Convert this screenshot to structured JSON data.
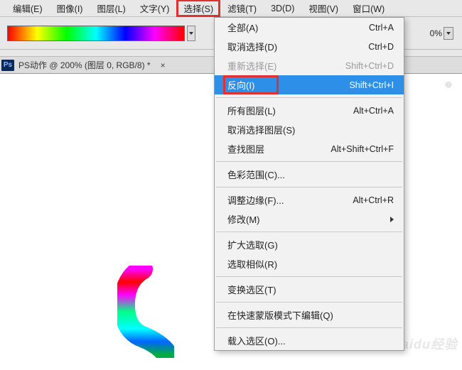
{
  "menubar": {
    "items": [
      {
        "label": "编辑(E)"
      },
      {
        "label": "图像(I)"
      },
      {
        "label": "图层(L)"
      },
      {
        "label": "文字(Y)"
      },
      {
        "label": "选择(S)",
        "highlighted": true
      },
      {
        "label": "滤镜(T)"
      },
      {
        "label": "3D(D)"
      },
      {
        "label": "视图(V)"
      },
      {
        "label": "窗口(W)"
      }
    ]
  },
  "toolbar": {
    "percent_label": "0%"
  },
  "doc": {
    "badge": "Ps",
    "title": "PS动作 @ 200% (图层 0, RGB/8) *",
    "close": "×"
  },
  "zoom_indicator": "⊚",
  "dropdown": {
    "items": [
      {
        "label": "全部(A)",
        "shortcut": "Ctrl+A"
      },
      {
        "label": "取消选择(D)",
        "shortcut": "Ctrl+D"
      },
      {
        "label": "重新选择(E)",
        "shortcut": "Shift+Ctrl+D",
        "disabled": true
      },
      {
        "label": "反向(I)",
        "shortcut": "Shift+Ctrl+I",
        "highlighted": true,
        "redbox": true
      },
      {
        "sep": true
      },
      {
        "label": "所有图层(L)",
        "shortcut": "Alt+Ctrl+A"
      },
      {
        "label": "取消选择图层(S)",
        "shortcut": ""
      },
      {
        "label": "查找图层",
        "shortcut": "Alt+Shift+Ctrl+F"
      },
      {
        "sep": true
      },
      {
        "label": "色彩范围(C)...",
        "shortcut": ""
      },
      {
        "sep": true
      },
      {
        "label": "调整边缘(F)...",
        "shortcut": "Alt+Ctrl+R"
      },
      {
        "label": "修改(M)",
        "shortcut": "",
        "submenu": true
      },
      {
        "sep": true
      },
      {
        "label": "扩大选取(G)",
        "shortcut": ""
      },
      {
        "label": "选取相似(R)",
        "shortcut": ""
      },
      {
        "sep": true
      },
      {
        "label": "变换选区(T)",
        "shortcut": ""
      },
      {
        "sep": true
      },
      {
        "label": "在快速蒙版模式下编辑(Q)",
        "shortcut": ""
      },
      {
        "sep": true
      },
      {
        "label": "载入选区(O)...",
        "shortcut": ""
      }
    ]
  },
  "watermark": "Baidu经验"
}
